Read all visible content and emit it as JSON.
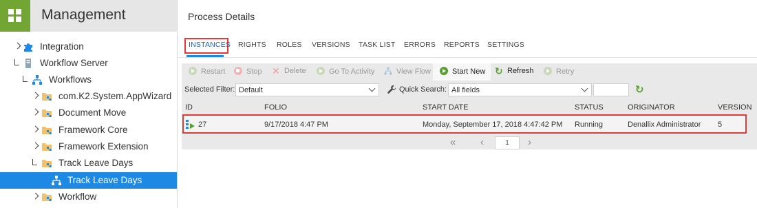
{
  "sidebar": {
    "title": "Management",
    "tree": [
      {
        "label": "Integration",
        "twisty": "collapsed",
        "icon": "puzzle-icon"
      },
      {
        "label": "Workflow Server",
        "twisty": "expanded",
        "icon": "server-icon"
      },
      {
        "label": "Workflows",
        "twisty": "expanded",
        "icon": "workflow-icon"
      },
      {
        "label": "com.K2.System.AppWizard",
        "twisty": "collapsed",
        "icon": "folder-workflow-icon"
      },
      {
        "label": "Document Move",
        "twisty": "collapsed",
        "icon": "folder-workflow-icon"
      },
      {
        "label": "Framework Core",
        "twisty": "collapsed",
        "icon": "folder-workflow-icon"
      },
      {
        "label": "Framework Extension",
        "twisty": "collapsed",
        "icon": "folder-workflow-icon"
      },
      {
        "label": "Track Leave Days",
        "twisty": "expanded",
        "icon": "folder-workflow-icon"
      },
      {
        "label": "Track Leave Days",
        "twisty": "none",
        "icon": "workflow-icon",
        "selected": true
      },
      {
        "label": "Workflow",
        "twisty": "collapsed",
        "icon": "folder-workflow-icon"
      }
    ]
  },
  "main": {
    "title": "Process Details",
    "tabs": [
      "INSTANCES",
      "RIGHTS",
      "ROLES",
      "VERSIONS",
      "TASK LIST",
      "ERRORS",
      "REPORTS",
      "SETTINGS"
    ],
    "active_tab": "INSTANCES",
    "toolbar": [
      {
        "label": "Restart",
        "icon": "play-circle-icon",
        "enabled": false
      },
      {
        "label": "Stop",
        "icon": "stop-circle-icon",
        "enabled": false
      },
      {
        "label": "Delete",
        "icon": "delete-x-icon",
        "enabled": false
      },
      {
        "label": "Go To Activity",
        "icon": "play-circle-icon",
        "enabled": false
      },
      {
        "label": "View Flow",
        "icon": "workflow-icon",
        "enabled": false
      },
      {
        "label": "Start New",
        "icon": "play-circle-icon",
        "enabled": true
      },
      {
        "label": "Refresh",
        "icon": "refresh-icon",
        "enabled": true
      },
      {
        "label": "Retry",
        "icon": "play-circle-icon",
        "enabled": false
      }
    ],
    "filter": {
      "selected_filter_label": "Selected Filter:",
      "selected_filter_value": "Default",
      "quick_search_label": "Quick Search:",
      "quick_search_field": "All fields",
      "search_text": ""
    },
    "columns": [
      "ID",
      "FOLIO",
      "START DATE",
      "STATUS",
      "ORIGINATOR",
      "VERSION"
    ],
    "rows": [
      {
        "id": "27",
        "folio": "9/17/2018 4:47 PM",
        "start_date": "Monday, September 17, 2018 4:47:42 PM",
        "status": "Running",
        "originator": "Denallix Administrator",
        "version": "5"
      }
    ],
    "pager": {
      "page": "1"
    }
  },
  "colors": {
    "accent": "#1e88e5",
    "logo_green": "#71a534",
    "highlight_red": "#e53935",
    "enabled_green": "#5a9e2f"
  }
}
